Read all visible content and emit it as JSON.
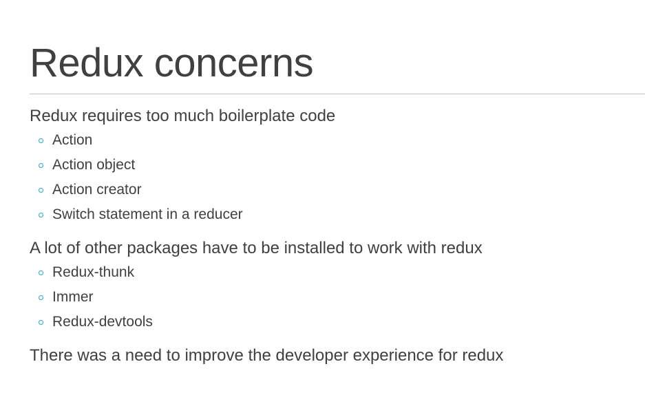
{
  "slide": {
    "title": "Redux concerns",
    "sections": [
      {
        "heading": "Redux requires too much boilerplate code",
        "items": [
          "Action",
          "Action object",
          "Action creator",
          "Switch statement in a reducer"
        ]
      },
      {
        "heading": "A lot of other packages have to be installed to work with redux",
        "items": [
          "Redux-thunk",
          "Immer",
          "Redux-devtools"
        ]
      },
      {
        "heading": "There was a need to improve the developer experience for redux",
        "items": []
      }
    ]
  },
  "colors": {
    "text": "#404040",
    "bullet": "#29a7cf",
    "rule": "#bfbfbf",
    "background": "#ffffff"
  },
  "icons": {
    "bullet": "hollow-circle-bullet-icon"
  }
}
